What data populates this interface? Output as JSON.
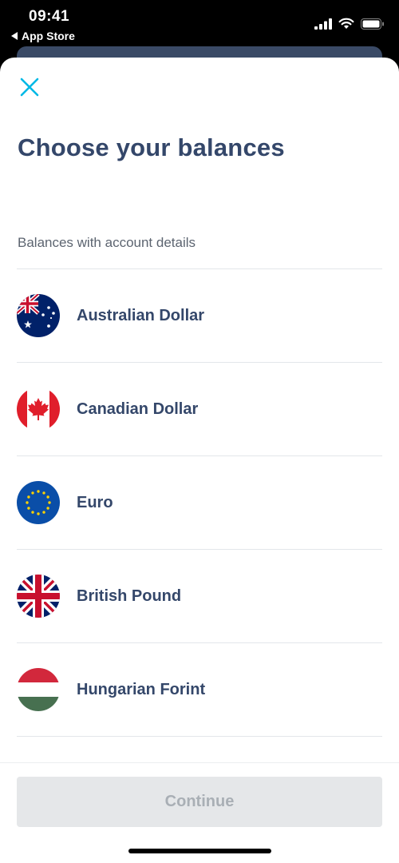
{
  "status_bar": {
    "time": "09:41",
    "back_label": "App Store"
  },
  "icons": {
    "close": "close-icon",
    "signal": "signal-icon",
    "wifi": "wifi-icon",
    "battery": "battery-icon",
    "back": "back-arrow-icon"
  },
  "header": {
    "title": "Choose your balances"
  },
  "section": {
    "label": "Balances with account details"
  },
  "balances": [
    {
      "label": "Australian Dollar",
      "flag": "australia-flag-icon"
    },
    {
      "label": "Canadian Dollar",
      "flag": "canada-flag-icon"
    },
    {
      "label": "Euro",
      "flag": "eu-flag-icon"
    },
    {
      "label": "British Pound",
      "flag": "uk-flag-icon"
    },
    {
      "label": "Hungarian Forint",
      "flag": "hungary-flag-icon"
    }
  ],
  "footer": {
    "continue_label": "Continue",
    "continue_state": "disabled"
  },
  "colors": {
    "accent": "#00b9e5",
    "title": "#34476a",
    "muted": "#5c6470",
    "disabled_bg": "#e5e7e9",
    "disabled_text": "#a9afb5"
  }
}
